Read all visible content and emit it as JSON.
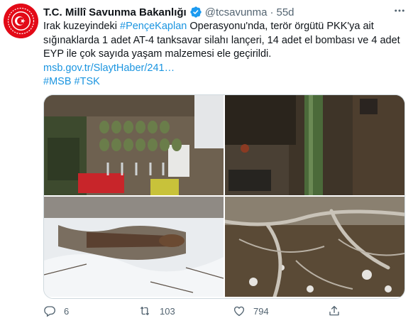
{
  "author": {
    "display_name": "T.C. Millî Savunma Bakanlığı",
    "handle": "@tcsavunma",
    "separator": "·",
    "time": "55d"
  },
  "tweet": {
    "text_1": "Irak kuzeyindeki ",
    "hashtag_1": "#PençeKaplan",
    "text_2": " Operasyonu'nda, terör örgütü PKK'ya ait sığınaklarda 1 adet AT-4 tanksavar silahı lançeri, 14 adet el bombası ve 4 adet EYP ile çok sayıda yaşam malzemesi ele geçirildi.",
    "link": "msb.gov.tr/SlaytHaber/241…",
    "hashtag_2": "#MSB",
    "hashtag_3": "#TSK"
  },
  "stats": {
    "replies": "6",
    "retweets": "103",
    "likes": "794"
  },
  "colors": {
    "link": "#1b95e0",
    "verified": "#1d9bf0",
    "avatar_bg": "#e30a17"
  },
  "icons": [
    "msb-logo",
    "verified-badge-icon",
    "more-icon",
    "reply-icon",
    "retweet-icon",
    "like-icon",
    "share-icon"
  ]
}
